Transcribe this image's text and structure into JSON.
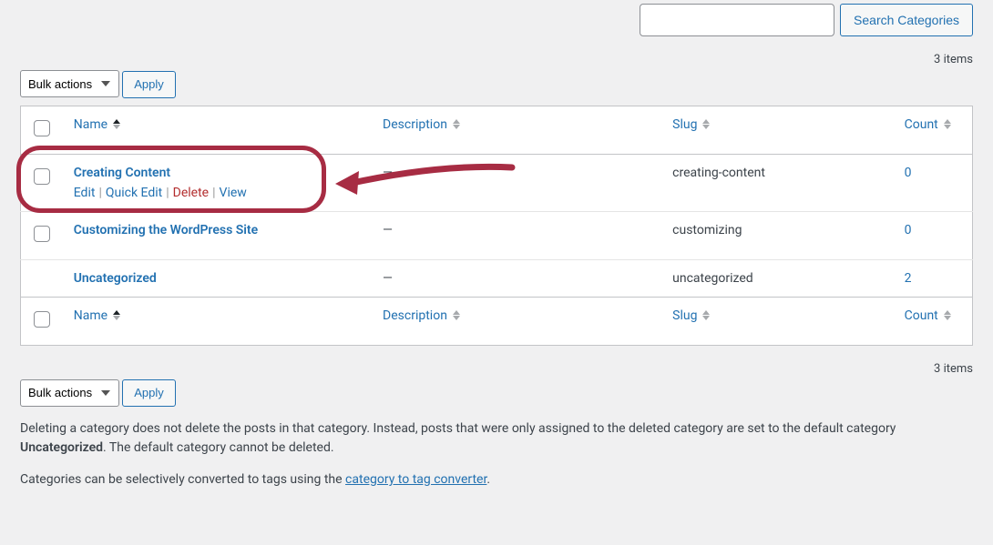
{
  "search": {
    "value": "",
    "button": "Search Categories"
  },
  "items_count": "3 items",
  "bulk": {
    "selected": "Bulk actions",
    "apply": "Apply"
  },
  "columns": {
    "name": "Name",
    "description": "Description",
    "slug": "Slug",
    "count": "Count"
  },
  "row_actions": {
    "edit": "Edit",
    "quick": "Quick Edit",
    "delete": "Delete",
    "view": "View"
  },
  "rows": [
    {
      "name": "Creating Content",
      "description": "—",
      "slug": "creating-content",
      "count": "0",
      "show_actions": true
    },
    {
      "name": "Customizing the WordPress Site",
      "description": "—",
      "slug": "customizing",
      "count": "0",
      "show_actions": false
    },
    {
      "name": "Uncategorized",
      "description": "—",
      "slug": "uncategorized",
      "count": "2",
      "show_actions": false,
      "hide_cb": true
    }
  ],
  "notes": {
    "p1a": "Deleting a category does not delete the posts in that category. Instead, posts that were only assigned to the deleted category are set to the default category ",
    "p1b": "Uncategorized",
    "p1c": ". The default category cannot be deleted.",
    "p2a": "Categories can be selectively converted to tags using the ",
    "p2link": "category to tag converter",
    "p2b": "."
  }
}
